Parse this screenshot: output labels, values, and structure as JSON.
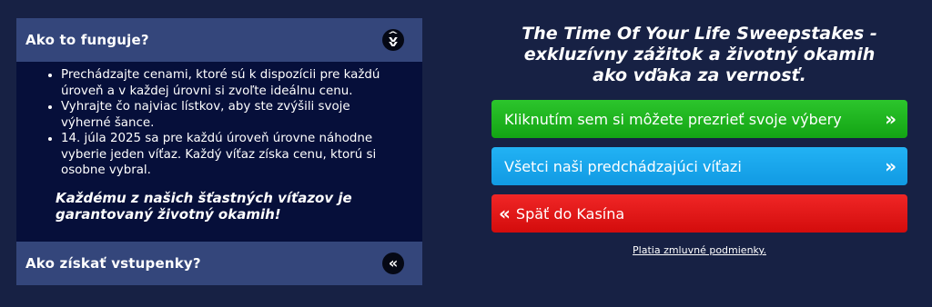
{
  "faq": {
    "section1": {
      "title": "Ako to funguje?",
      "icon": "collapse-icon",
      "items": [
        "Prechádzajte cenami, ktoré sú k dispozícii pre každú úroveň a v každej úrovni si zvoľte ideálnu cenu.",
        "Vyhrajte čo najviac lístkov, aby ste zvýšili svoje výherné šance.",
        "14. júla 2025 sa pre každú úroveň úrovne náhodne vyberie jeden víťaz. Každý víťaz získa cenu, ktorú si osobne vybral."
      ],
      "guarantee": "Každému z našich šťastných víťazov je garantovaný životný okamih!"
    },
    "section2": {
      "title": "Ako získať vstupenky?",
      "icon": "expand-icon",
      "icon_glyph": "«"
    }
  },
  "promo": {
    "title": "The Time Of Your Life Sweepstakes - exkluzívny zážitok a životný okamih ako vďaka za vernosť.",
    "buttons": {
      "choices": {
        "label": "Kliknutím sem si môžete prezrieť svoje výbery",
        "chevron": "»",
        "color": "#1db31d"
      },
      "winners": {
        "label": "Všetci naši predchádzajúci víťazi",
        "chevron": "»",
        "color": "#17a5ec"
      },
      "back": {
        "label": "Späť do Kasína",
        "chevron": "«",
        "color": "#e51919"
      }
    },
    "terms": "Platia zmluvné podmienky."
  },
  "colors": {
    "page_bg": "#172144",
    "accordion_header": "#34467b",
    "accordion_body": "#060f3a"
  }
}
